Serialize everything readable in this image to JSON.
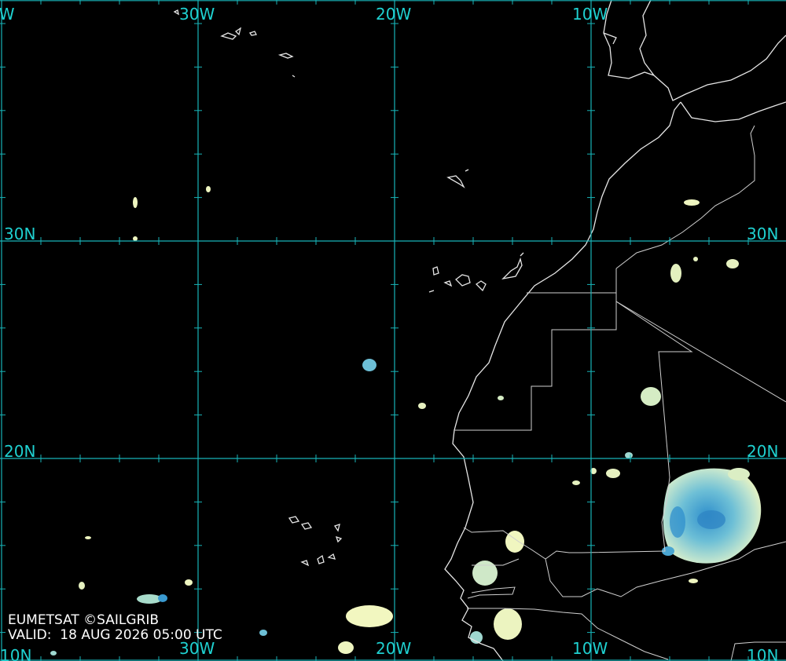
{
  "map": {
    "longitude_labels": [
      "0W",
      "30W",
      "20W",
      "10W"
    ],
    "latitude_labels": [
      "30N",
      "20N",
      "10N"
    ],
    "colors": {
      "background": "#000000",
      "graticule": "#18b4b8",
      "labels": "#1fd0d0",
      "coastline": "#e6e6e6",
      "cloud_light": "#f2f7c0",
      "cloud_mid": "#9fd8d0",
      "cloud_deep": "#3a9ad0"
    }
  },
  "credit": {
    "source": "EUMETSAT ©SAILGRIB",
    "valid_label": "VALID:",
    "valid_time": "18 AUG 2026 05:00 UTC"
  }
}
